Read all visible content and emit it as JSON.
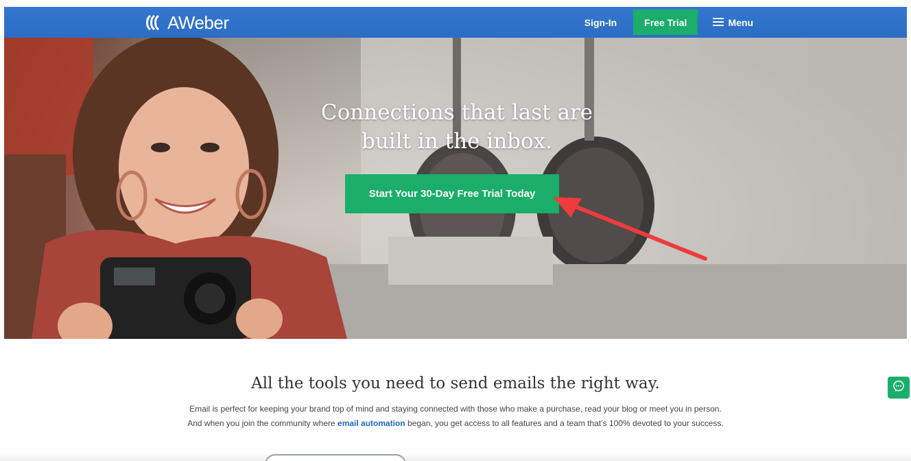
{
  "header": {
    "logo_text": "AWeber",
    "sign_in": "Sign-In",
    "free_trial": "Free Trial",
    "menu": "Menu"
  },
  "hero": {
    "title_line1": "Connections that last are",
    "title_line2": "built in the inbox.",
    "cta": "Start Your 30-Day Free Trial Today"
  },
  "section": {
    "title": "All the tools you need to send emails the right way.",
    "line1": "Email is perfect for keeping your brand top of mind and staying connected with those who make a purchase, read your blog or meet you in person.",
    "line2_before": "And when you join the community where ",
    "line2_link": "email automation",
    "line2_after": " began, you get access to all features and a team that’s 100% devoted to your success."
  },
  "colors": {
    "nav_blue": "#2f71c8",
    "accent_green": "#1aae6a",
    "link_blue": "#1f69c3",
    "annotation_red": "#ee3b3b"
  },
  "icons": {
    "logo": "aweber-logo-icon",
    "menu": "hamburger-icon",
    "chat": "chat-bubble-icon",
    "annotation": "red-arrow-annotation"
  }
}
